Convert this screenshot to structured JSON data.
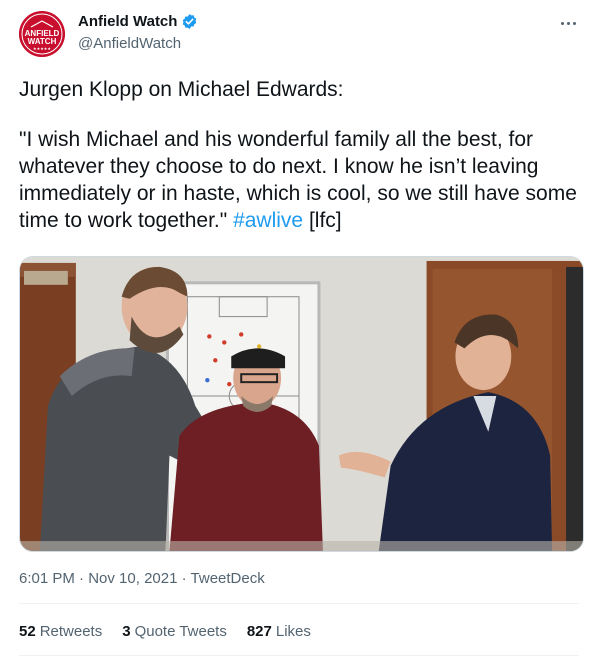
{
  "author": {
    "display_name": "Anfield Watch",
    "handle": "@AnfieldWatch",
    "avatar_text_line1": "ANFIELD",
    "avatar_text_line2": "WATCH",
    "verified": true
  },
  "tweet": {
    "line1": "Jurgen Klopp on Michael Edwards:",
    "quote": "\"I wish Michael and his wonderful family all the best, for whatever they choose to do next. I know he isn’t leaving immediately or in haste, which is cool, so we still have some time to work together.\"",
    "hashtag": "#awlive",
    "tag_suffix": "[lfc]"
  },
  "meta": {
    "time": "6:01 PM",
    "separator": "·",
    "date": "Nov 10, 2021",
    "source": "TweetDeck"
  },
  "stats": [
    {
      "count": "52",
      "label": "Retweets"
    },
    {
      "count": "3",
      "label": "Quote Tweets"
    },
    {
      "count": "827",
      "label": "Likes"
    }
  ],
  "colors": {
    "accent": "#1d9bf0",
    "brand": "#c8102e",
    "secondary_text": "#536471"
  },
  "icons": {
    "verified": "verified-badge-icon",
    "more": "more-options-icon"
  }
}
